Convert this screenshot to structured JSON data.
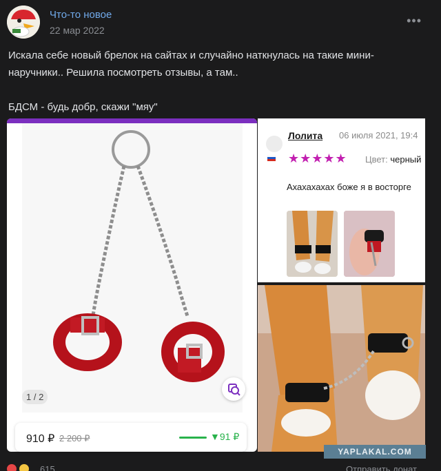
{
  "post": {
    "author": "Что-то новое",
    "date": "22 мар 2022",
    "text_line1": "Искала себе новый брелок на сайтах и случайно наткнулась на такие мини-",
    "text_line2": "наручники.. Решила посмотреть отзывы, а там..",
    "text_line3": "БДСМ - будь добр, скажи \"мяу\""
  },
  "product": {
    "pager": "1 / 2",
    "price": "910 ₽",
    "old_price": "2 200 ₽",
    "price_drop": "▼91 ₽"
  },
  "review": {
    "author": "Лолита",
    "date": "06 июля 2021, 19:4",
    "stars": "★★★★★",
    "color_label": "Цвет:",
    "color_value": "черный",
    "text": "Ахахахахах боже я в восторге"
  },
  "watermark": "YAPLAKAL.COM",
  "footer": {
    "reactions_count": "615",
    "share_label": "Отправить донат"
  },
  "colors": {
    "background": "#1b1b1c",
    "link": "#71aaeb",
    "accent_purple": "#7b2fbf",
    "star_color": "#c21fb0",
    "price_green": "#28b24b"
  }
}
